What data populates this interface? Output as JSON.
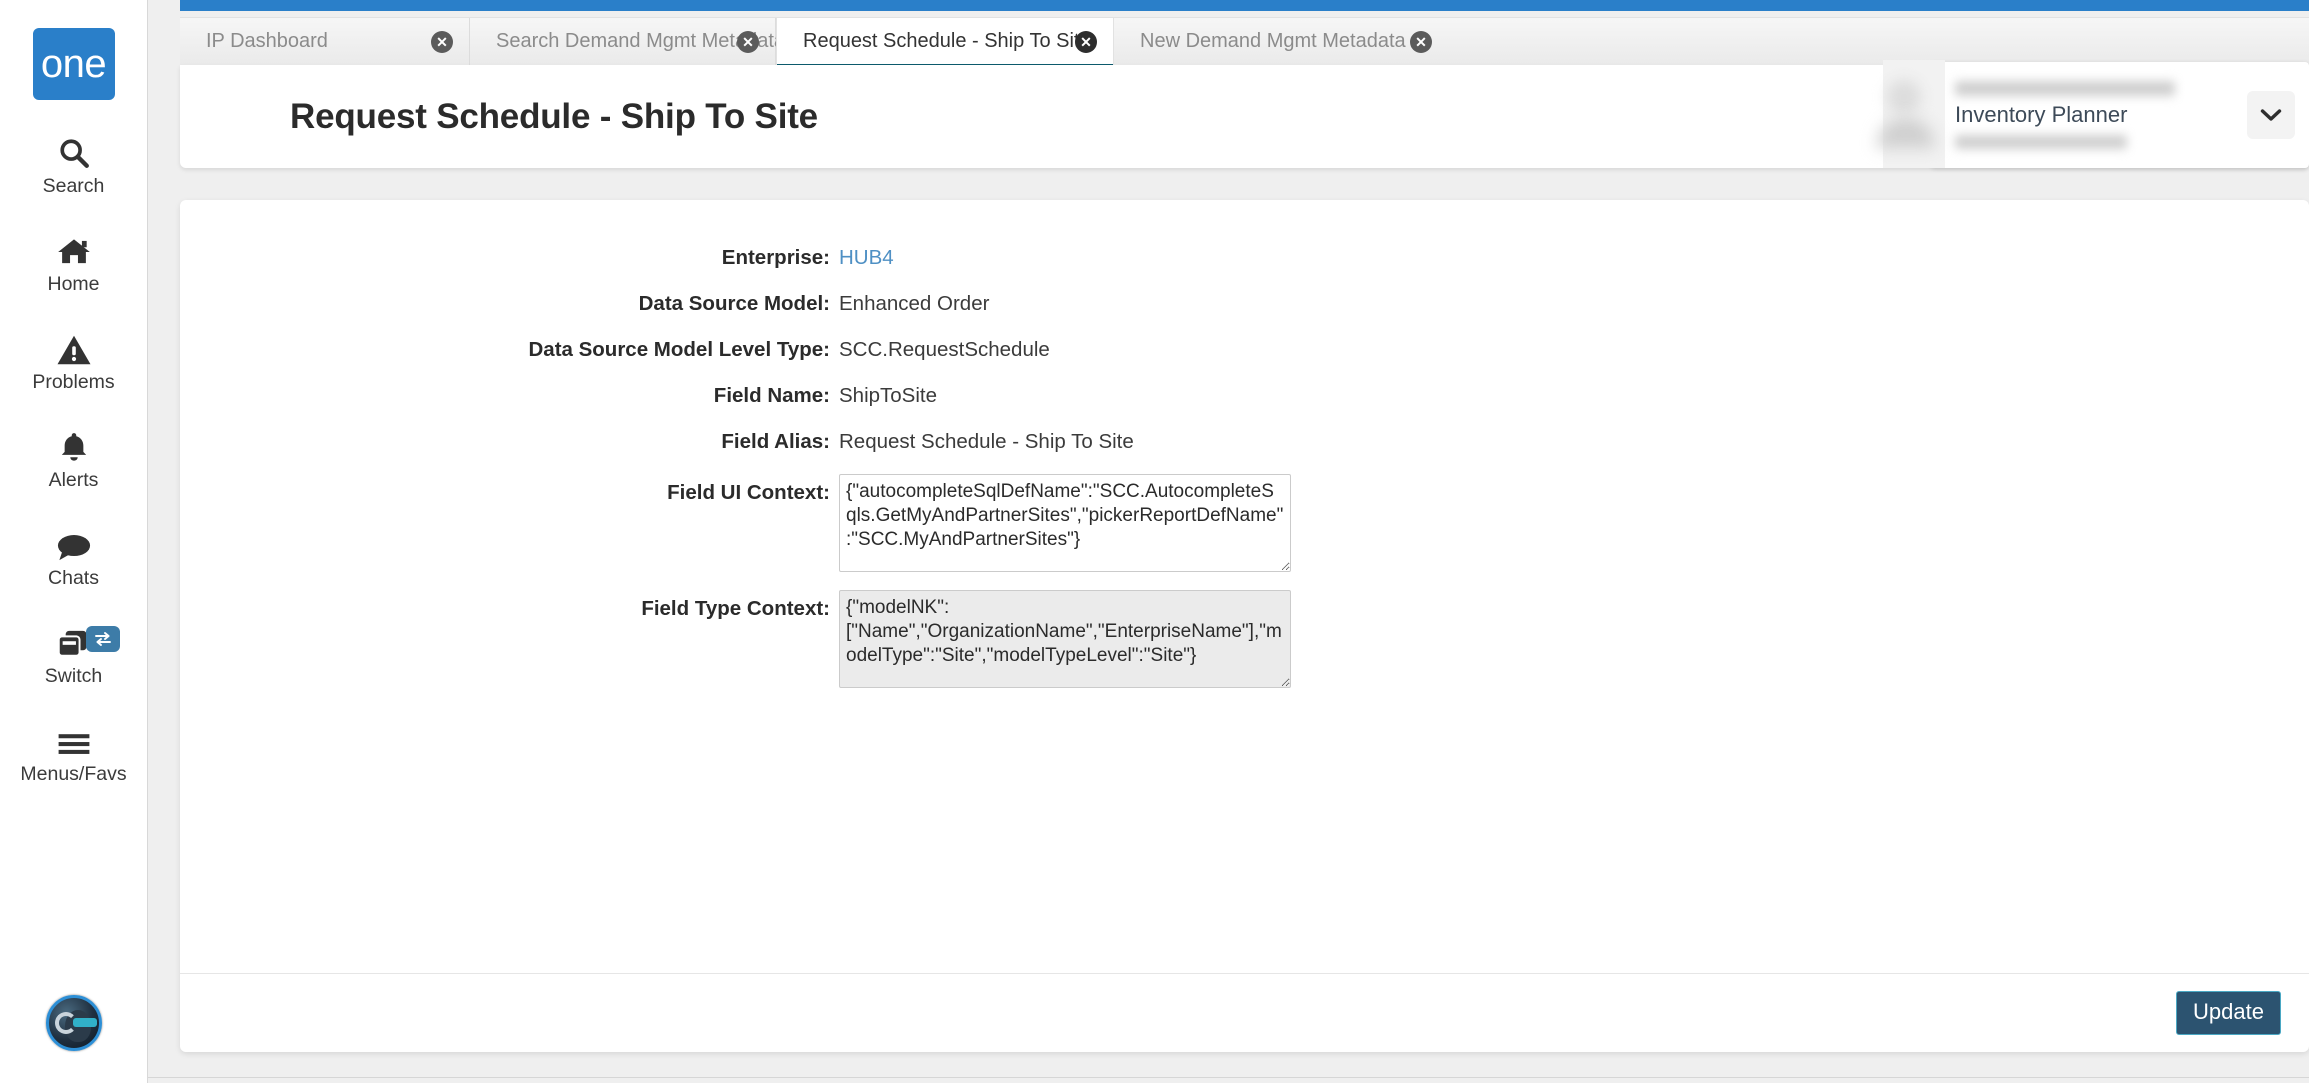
{
  "sidebar": {
    "brand": "one",
    "items": [
      {
        "label": "Search",
        "icon": "search-icon"
      },
      {
        "label": "Home",
        "icon": "home-icon"
      },
      {
        "label": "Problems",
        "icon": "warning-triangle-icon"
      },
      {
        "label": "Alerts",
        "icon": "bell-icon"
      },
      {
        "label": "Chats",
        "icon": "chat-bubble-icon"
      },
      {
        "label": "Switch",
        "icon": "switch-windows-icon",
        "badge_icon": "swap-arrows-icon"
      },
      {
        "label": "Menus/Favs",
        "icon": "hamburger-icon"
      }
    ],
    "avatar_icon": "user-avatar-orb-icon"
  },
  "tabs": [
    {
      "label": "IP Dashboard",
      "active": false,
      "close_icon": "close-circle-icon"
    },
    {
      "label": "Search Demand Mgmt Metadata",
      "active": false,
      "close_icon": "close-circle-icon"
    },
    {
      "label": "Request Schedule - Ship To Site",
      "active": true,
      "close_icon": "close-circle-icon"
    },
    {
      "label": "New Demand Mgmt Metadata",
      "active": false,
      "close_icon": "close-circle-icon"
    }
  ],
  "header": {
    "title": "Request Schedule - Ship To Site",
    "refresh_icon": "refresh-icon",
    "close_icon": "close-x-icon",
    "menu_icon": "hamburger-menu-icon"
  },
  "user_panel": {
    "name_redacted": "",
    "role": "Inventory Planner",
    "sub_redacted": "",
    "caret_icon": "chevron-down-icon"
  },
  "form": {
    "fields": [
      {
        "label": "Enterprise",
        "value": "HUB4",
        "type": "link"
      },
      {
        "label": "Data Source Model",
        "value": "Enhanced Order",
        "type": "text"
      },
      {
        "label": "Data Source Model Level Type",
        "value": "SCC.RequestSchedule",
        "type": "text"
      },
      {
        "label": "Field Name",
        "value": "ShipToSite",
        "type": "text"
      },
      {
        "label": "Field Alias",
        "value": "Request Schedule - Ship To Site",
        "type": "text"
      }
    ],
    "ui_context": {
      "label": "Field UI Context",
      "value": "{\"autocompleteSqlDefName\":\"SCC.AutocompleteSqls.GetMyAndPartnerSites\",\"pickerReportDefName\":\"SCC.MyAndPartnerSites\"}"
    },
    "type_context": {
      "label": "Field Type Context",
      "value": "{\"modelNK\":\n[\"Name\",\"OrganizationName\",\"EnterpriseName\"],\"modelType\":\"Site\",\"modelTypeLevel\":\"Site\"}"
    }
  },
  "footer": {
    "update_label": "Update"
  },
  "colors": {
    "brand_blue": "#2a7fc9",
    "teal_action": "#0d5c6e",
    "active_tab_underline": "#0d5c6e",
    "link_blue": "#4f90c4",
    "update_bg": "#2c5370",
    "update_border": "#4aa8c4",
    "page_bg": "#efefef"
  }
}
